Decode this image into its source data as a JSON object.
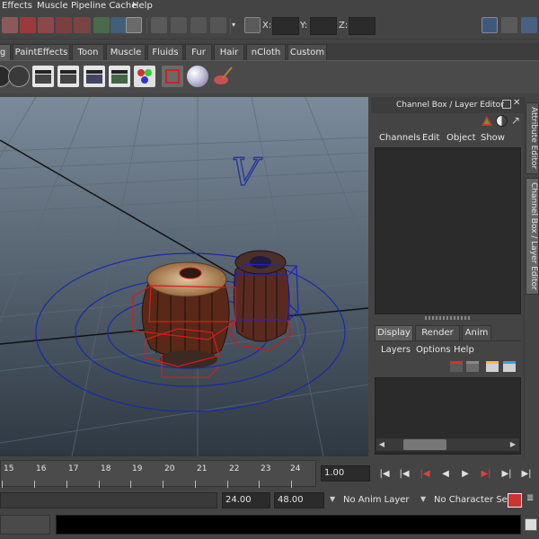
{
  "menubar": {
    "items": [
      "Effects",
      "Muscle",
      "Pipeline Cache",
      "Help"
    ]
  },
  "statusline": {
    "x_label": "X:",
    "y_label": "Y:",
    "z_label": "Z:"
  },
  "shelf": {
    "tabs": [
      "g",
      "PaintEffects",
      "Toon",
      "Muscle",
      "Fluids",
      "Fur",
      "Hair",
      "nCloth",
      "Custom"
    ],
    "active_tab": "g"
  },
  "viewport": {
    "view_cube_letter": "V"
  },
  "channel_box": {
    "title": "Channel Box / Layer Editor",
    "menus": [
      "Channels",
      "Edit",
      "Object",
      "Show"
    ]
  },
  "layer_editor": {
    "tabs": [
      "Display",
      "Render",
      "Anim"
    ],
    "active_tab": "Display",
    "menus": [
      "Layers",
      "Options",
      "Help"
    ]
  },
  "side_tabs": [
    "Attribute Editor",
    "Channel Box / Layer Editor"
  ],
  "timeline": {
    "ticks": [
      "15",
      "16",
      "17",
      "18",
      "19",
      "20",
      "21",
      "22",
      "23",
      "24"
    ],
    "current_time": "1.00"
  },
  "range": {
    "end_time": "24.00",
    "anim_end": "48.00",
    "anim_layer": "No Anim Layer",
    "character_set": "No Character Set"
  }
}
